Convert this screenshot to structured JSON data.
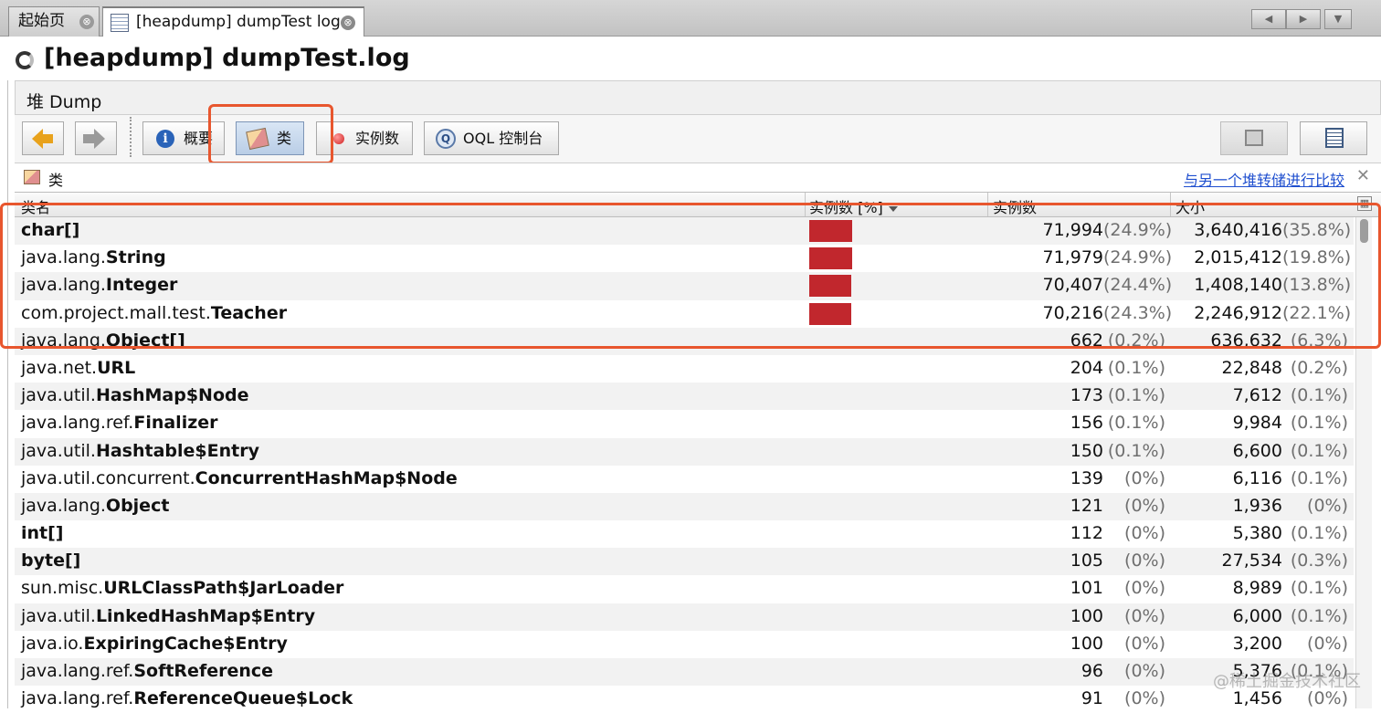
{
  "tabs": [
    {
      "label": "起始页",
      "close": "⊗"
    },
    {
      "label": "[heapdump] dumpTest log",
      "close": "⊗"
    }
  ],
  "tab_nav": {
    "prev": "◀",
    "next": "▶",
    "menu": "▼"
  },
  "page_title": "[heapdump] dumpTest.log",
  "section_label": "堆 Dump",
  "toolbar": {
    "summary_label": "概要",
    "classes_label": "类",
    "instances_label": "实例数",
    "oql_label": "OQL 控制台"
  },
  "panel": {
    "title": "类",
    "compare_link": "与另一个堆转储进行比较",
    "close": "✕"
  },
  "columns": {
    "name": "类名",
    "bar": "实例数 [%]",
    "count": "实例数",
    "size": "大小"
  },
  "rows": [
    {
      "prefix": "",
      "bold": "char[]",
      "bar_pct": 24.9,
      "count": "71,994",
      "count_pct": "(24.9%)",
      "size": "3,640,416",
      "size_pct": "(35.8%)"
    },
    {
      "prefix": "java.lang.",
      "bold": "String",
      "bar_pct": 24.9,
      "count": "71,979",
      "count_pct": "(24.9%)",
      "size": "2,015,412",
      "size_pct": "(19.8%)"
    },
    {
      "prefix": "java.lang.",
      "bold": "Integer",
      "bar_pct": 24.4,
      "count": "70,407",
      "count_pct": "(24.4%)",
      "size": "1,408,140",
      "size_pct": "(13.8%)"
    },
    {
      "prefix": "com.project.mall.test.",
      "bold": "Teacher",
      "bar_pct": 24.3,
      "count": "70,216",
      "count_pct": "(24.3%)",
      "size": "2,246,912",
      "size_pct": "(22.1%)"
    },
    {
      "prefix": "java.lang.",
      "bold": "Object[]",
      "bar_pct": 0.2,
      "count": "662",
      "count_pct": "(0.2%)",
      "size": "636,632",
      "size_pct": "(6.3%)"
    },
    {
      "prefix": "java.net.",
      "bold": "URL",
      "bar_pct": 0.1,
      "count": "204",
      "count_pct": "(0.1%)",
      "size": "22,848",
      "size_pct": "(0.2%)"
    },
    {
      "prefix": "java.util.",
      "bold": "HashMap$Node",
      "bar_pct": 0.1,
      "count": "173",
      "count_pct": "(0.1%)",
      "size": "7,612",
      "size_pct": "(0.1%)"
    },
    {
      "prefix": "java.lang.ref.",
      "bold": "Finalizer",
      "bar_pct": 0.1,
      "count": "156",
      "count_pct": "(0.1%)",
      "size": "9,984",
      "size_pct": "(0.1%)"
    },
    {
      "prefix": "java.util.",
      "bold": "Hashtable$Entry",
      "bar_pct": 0.1,
      "count": "150",
      "count_pct": "(0.1%)",
      "size": "6,600",
      "size_pct": "(0.1%)"
    },
    {
      "prefix": "java.util.concurrent.",
      "bold": "ConcurrentHashMap$Node",
      "bar_pct": 0,
      "count": "139",
      "count_pct": "(0%)",
      "size": "6,116",
      "size_pct": "(0.1%)"
    },
    {
      "prefix": "java.lang.",
      "bold": "Object",
      "bar_pct": 0,
      "count": "121",
      "count_pct": "(0%)",
      "size": "1,936",
      "size_pct": "(0%)"
    },
    {
      "prefix": "",
      "bold": "int[]",
      "bar_pct": 0,
      "count": "112",
      "count_pct": "(0%)",
      "size": "5,380",
      "size_pct": "(0.1%)"
    },
    {
      "prefix": "",
      "bold": "byte[]",
      "bar_pct": 0,
      "count": "105",
      "count_pct": "(0%)",
      "size": "27,534",
      "size_pct": "(0.3%)"
    },
    {
      "prefix": "sun.misc.",
      "bold": "URLClassPath$JarLoader",
      "bar_pct": 0,
      "count": "101",
      "count_pct": "(0%)",
      "size": "8,989",
      "size_pct": "(0.1%)"
    },
    {
      "prefix": "java.util.",
      "bold": "LinkedHashMap$Entry",
      "bar_pct": 0,
      "count": "100",
      "count_pct": "(0%)",
      "size": "6,000",
      "size_pct": "(0.1%)"
    },
    {
      "prefix": "java.io.",
      "bold": "ExpiringCache$Entry",
      "bar_pct": 0,
      "count": "100",
      "count_pct": "(0%)",
      "size": "3,200",
      "size_pct": "(0%)"
    },
    {
      "prefix": "java.lang.ref.",
      "bold": "SoftReference",
      "bar_pct": 0,
      "count": "96",
      "count_pct": "(0%)",
      "size": "5,376",
      "size_pct": "(0.1%)"
    },
    {
      "prefix": "java.lang.ref.",
      "bold": "ReferenceQueue$Lock",
      "bar_pct": 0,
      "count": "91",
      "count_pct": "(0%)",
      "size": "1,456",
      "size_pct": "(0%)"
    }
  ],
  "watermark": "@稀土掘金技术社区",
  "colors": {
    "bar": "#c1272d",
    "highlight": "#e8562e",
    "link": "#1f4fcf"
  },
  "icons": {
    "back": "arrow-left-icon",
    "forward": "arrow-right-icon",
    "summary": "info-icon",
    "classes": "class-icon",
    "instances": "instance-dot-icon",
    "oql": "oql-console-icon"
  }
}
